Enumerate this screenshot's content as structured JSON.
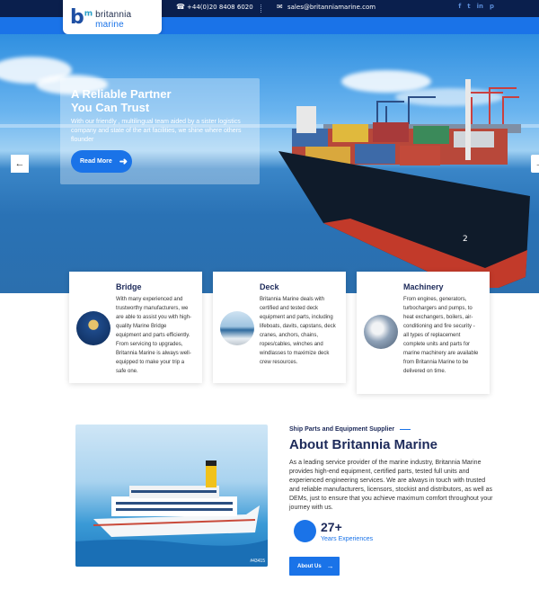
{
  "header": {
    "brand_name": "britannia",
    "brand_suffix": "marine",
    "phone": "+44(0)20 8408 6020",
    "email": "sales@britanniamarine.com",
    "socials": [
      "f",
      "t",
      "in",
      "p"
    ]
  },
  "hero": {
    "title_line1": "A Reliable Partner",
    "title_line2": "You Can Trust",
    "text": "With our friendly , multilingual team aided by a sister logistics company and state of the art facilities, we shine where others flounder",
    "button_label": "Read More"
  },
  "services": [
    {
      "title": "Bridge",
      "desc": "With many experienced and trustworthy manufacturers, we are able to assist you with high-quality Marine Bridge equipment and parts efficiently. From servicing to upgrades, Britannia Marine is always well-equipped to make your trip a safe one."
    },
    {
      "title": "Deck",
      "desc": "Britannia Marine deals with certified and tested deck equipment and parts, including lifeboats, davits, capstans, deck cranes, anchors, chains, ropes/cables, winches and windlasses to maximize deck crew resources."
    },
    {
      "title": "Machinery",
      "desc": "From engines, generators, turbochargers and pumps, to heat exchangers, boilers, air-conditioning and fire security - all types of replacement complete units and parts for marine machinery are available from Britannia Marine to be delivered on time."
    }
  ],
  "about": {
    "subtitle": "Ship Parts and Equipment Supplier",
    "title": "About Britannia Marine",
    "text": "As a leading service provider of the marine industry, Britannia Marine provides high-end equipment, certified parts, tested full units and experienced engineering services. We are always in touch with trusted and reliable manufacturers, licensors, stockist and distributors, as well as DEMs, just to ensure that you achieve maximum comfort throughout your journey with us.",
    "exp_number": "27+",
    "exp_label": "Years Experiences",
    "button_label": "About Us",
    "image_watermark": "#43415"
  },
  "colors": {
    "navy": "#0a1f4d",
    "accent": "#1a73e8",
    "heading": "#1d2a5a"
  },
  "icons": [
    "phone-icon",
    "mail-icon",
    "arrow-right-icon",
    "arrow-left-icon",
    "facebook-icon",
    "twitter-icon",
    "linkedin-icon",
    "pinterest-icon"
  ]
}
